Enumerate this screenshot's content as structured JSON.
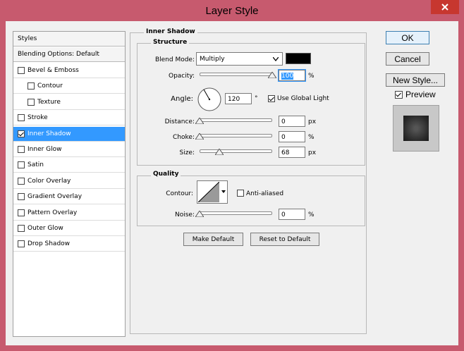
{
  "window": {
    "title": "Layer Style"
  },
  "styles_list": {
    "header": "Styles",
    "blending": "Blending Options: Default",
    "items": [
      {
        "label": "Bevel & Emboss",
        "checked": false
      },
      {
        "label": "Contour",
        "checked": false
      },
      {
        "label": "Texture",
        "checked": false
      },
      {
        "label": "Stroke",
        "checked": false
      },
      {
        "label": "Inner Shadow",
        "checked": true
      },
      {
        "label": "Inner Glow",
        "checked": false
      },
      {
        "label": "Satin",
        "checked": false
      },
      {
        "label": "Color Overlay",
        "checked": false
      },
      {
        "label": "Gradient Overlay",
        "checked": false
      },
      {
        "label": "Pattern Overlay",
        "checked": false
      },
      {
        "label": "Outer Glow",
        "checked": false
      },
      {
        "label": "Drop Shadow",
        "checked": false
      }
    ]
  },
  "panel": {
    "title": "Inner Shadow",
    "structure": {
      "label": "Structure",
      "blend_mode_label": "Blend Mode:",
      "blend_mode_value": "Multiply",
      "shadow_color": "#000000",
      "opacity_label": "Opacity:",
      "opacity_value": "100",
      "opacity_unit": "%",
      "opacity_fraction": 1.0,
      "angle_label": "Angle:",
      "angle_value": "120",
      "angle_unit": "°",
      "use_global_light_label": "Use Global Light",
      "use_global_light_checked": true,
      "distance_label": "Distance:",
      "distance_value": "0",
      "distance_unit": "px",
      "distance_fraction": 0.0,
      "choke_label": "Choke:",
      "choke_value": "0",
      "choke_unit": "%",
      "choke_fraction": 0.0,
      "size_label": "Size:",
      "size_value": "68",
      "size_unit": "px",
      "size_fraction": 0.27
    },
    "quality": {
      "label": "Quality",
      "contour_label": "Contour:",
      "anti_aliased_label": "Anti-aliased",
      "anti_aliased_checked": false,
      "noise_label": "Noise:",
      "noise_value": "0",
      "noise_unit": "%",
      "noise_fraction": 0.0
    },
    "make_default": "Make Default",
    "reset_default": "Reset to Default"
  },
  "buttons": {
    "ok": "OK",
    "cancel": "Cancel",
    "new_style": "New Style...",
    "preview": "Preview",
    "preview_checked": true
  },
  "colors": {
    "title_bar": "#c75a6e",
    "close_button": "#c7372f",
    "selection": "#3399ff"
  }
}
